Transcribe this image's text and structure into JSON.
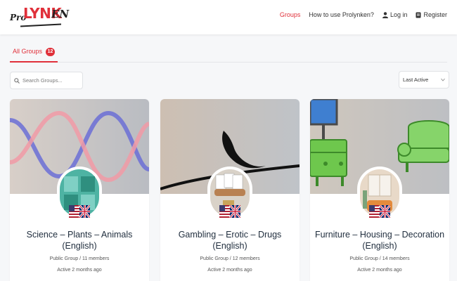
{
  "header": {
    "logo": {
      "pro": "Pro",
      "lynk": "LYNK",
      "en": "EN"
    },
    "nav": [
      {
        "label": "Groups",
        "icon": null,
        "active": true
      },
      {
        "label": "How to use Prolynken?",
        "icon": null,
        "active": false
      },
      {
        "label": "Log in",
        "icon": "user-icon",
        "active": false
      },
      {
        "label": "Register",
        "icon": "register-icon",
        "active": false
      }
    ]
  },
  "tabs": {
    "all_groups_label": "All Groups",
    "all_groups_count": "12"
  },
  "search": {
    "placeholder": "Search Groups..."
  },
  "sort": {
    "selected": "Last Active"
  },
  "groups": [
    {
      "title_line1": "Science – Plants – Animals",
      "title_line2": "(English)",
      "meta": "Public Group / 11 members",
      "active": "Active 2 months ago"
    },
    {
      "title_line1": "Gambling – Erotic – Drugs",
      "title_line2": "(English)",
      "meta": "Public Group / 12 members",
      "active": "Active 2 months ago"
    },
    {
      "title_line1": "Furniture – Housing – Decoration",
      "title_line2": "(English)",
      "meta": "Public Group / 14 members",
      "active": "Active 2 months ago"
    }
  ],
  "colors": {
    "accent": "#e0303a",
    "background": "#f6f7f9",
    "title": "#1f2d3d"
  }
}
